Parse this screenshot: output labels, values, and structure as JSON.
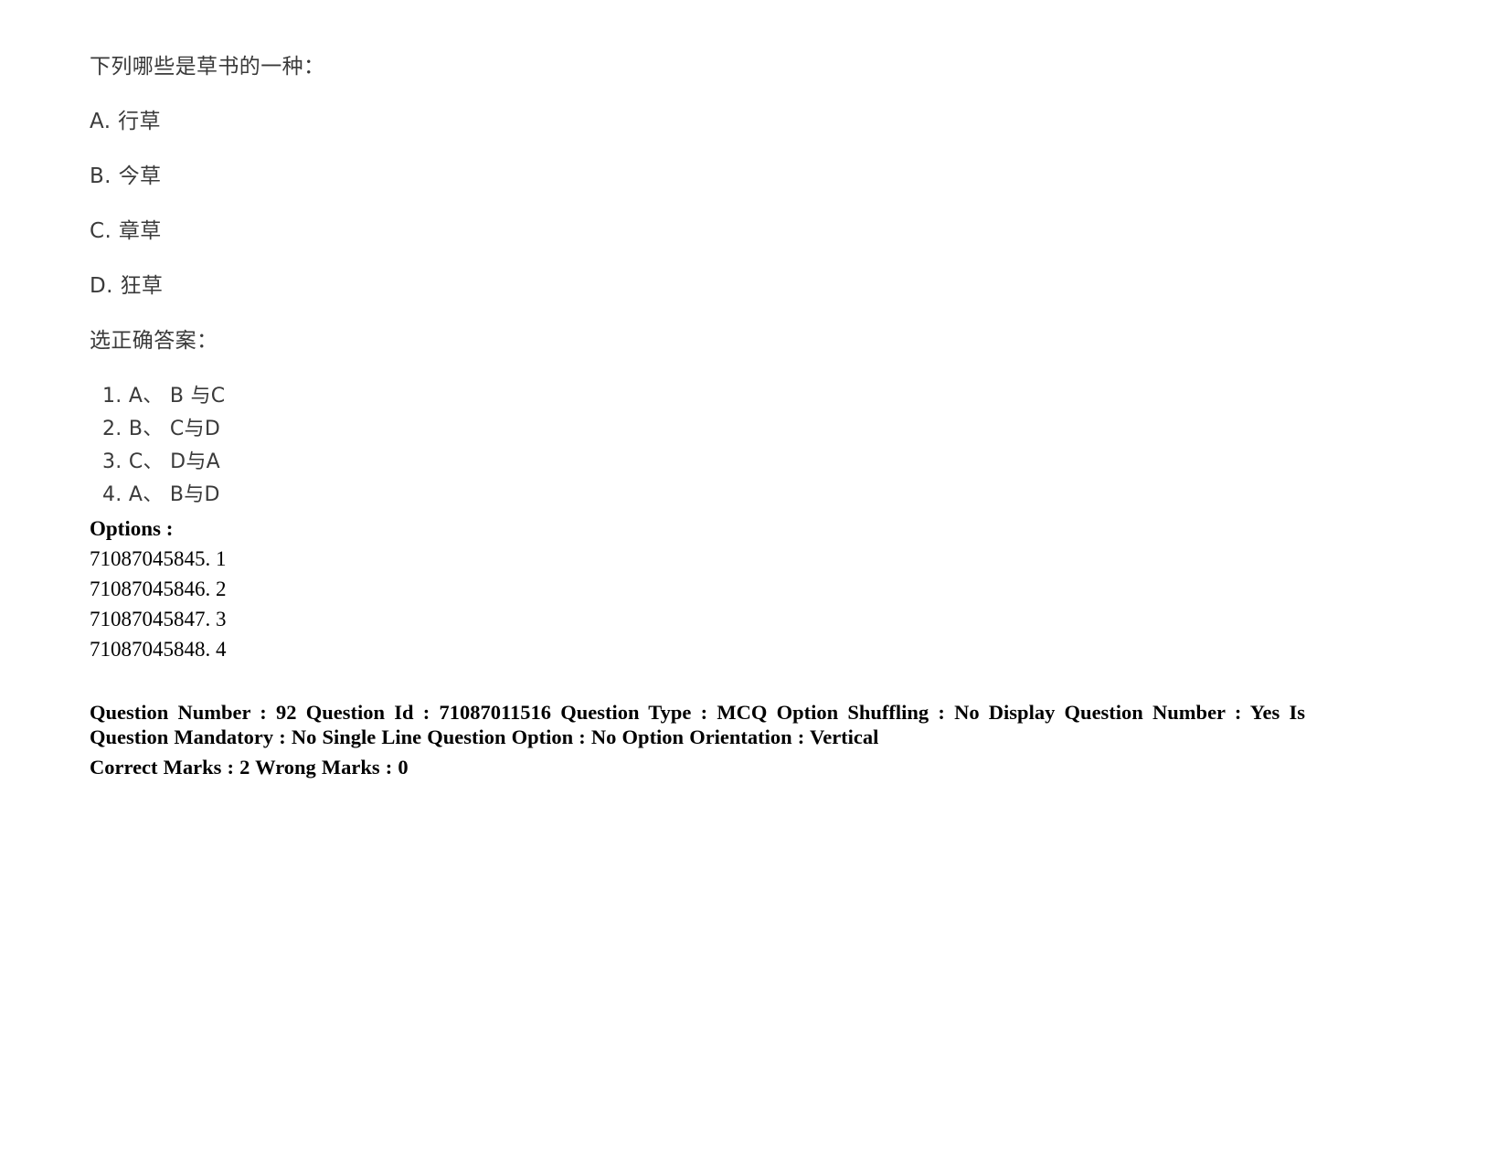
{
  "document": {
    "background_color": "#ffffff",
    "text_color": "#000000",
    "cjk_text_color": "#3a3a3a"
  },
  "question": {
    "stem": "下列哪些是草书的一种：",
    "choices": [
      "A. 行草",
      "B. 今草",
      "C. 章草",
      "D. 狂草"
    ],
    "prompt": "选正确答案：",
    "answer_options": [
      "1. A、 B 与C",
      "2. B、 C与D",
      "3. C、 D与A",
      "4. A、 B与D"
    ]
  },
  "options_section": {
    "label": "Options :",
    "items": [
      "71087045845. 1",
      "71087045846. 2",
      "71087045847. 3",
      "71087045848. 4"
    ]
  },
  "metadata": {
    "line1": "Question Number : 92 Question Id : 71087011516 Question Type : MCQ Option Shuffling : No Display Question Number : Yes Is Question Mandatory : No Single Line Question Option : No Option Orientation : Vertical",
    "line2": "Correct Marks : 2 Wrong Marks : 0",
    "fields": {
      "question_number": "92",
      "question_id": "71087011516",
      "question_type": "MCQ",
      "option_shuffling": "No",
      "display_question_number": "Yes",
      "is_question_mandatory": "No",
      "single_line_question_option": "No",
      "option_orientation": "Vertical",
      "correct_marks": "2",
      "wrong_marks": "0"
    }
  }
}
